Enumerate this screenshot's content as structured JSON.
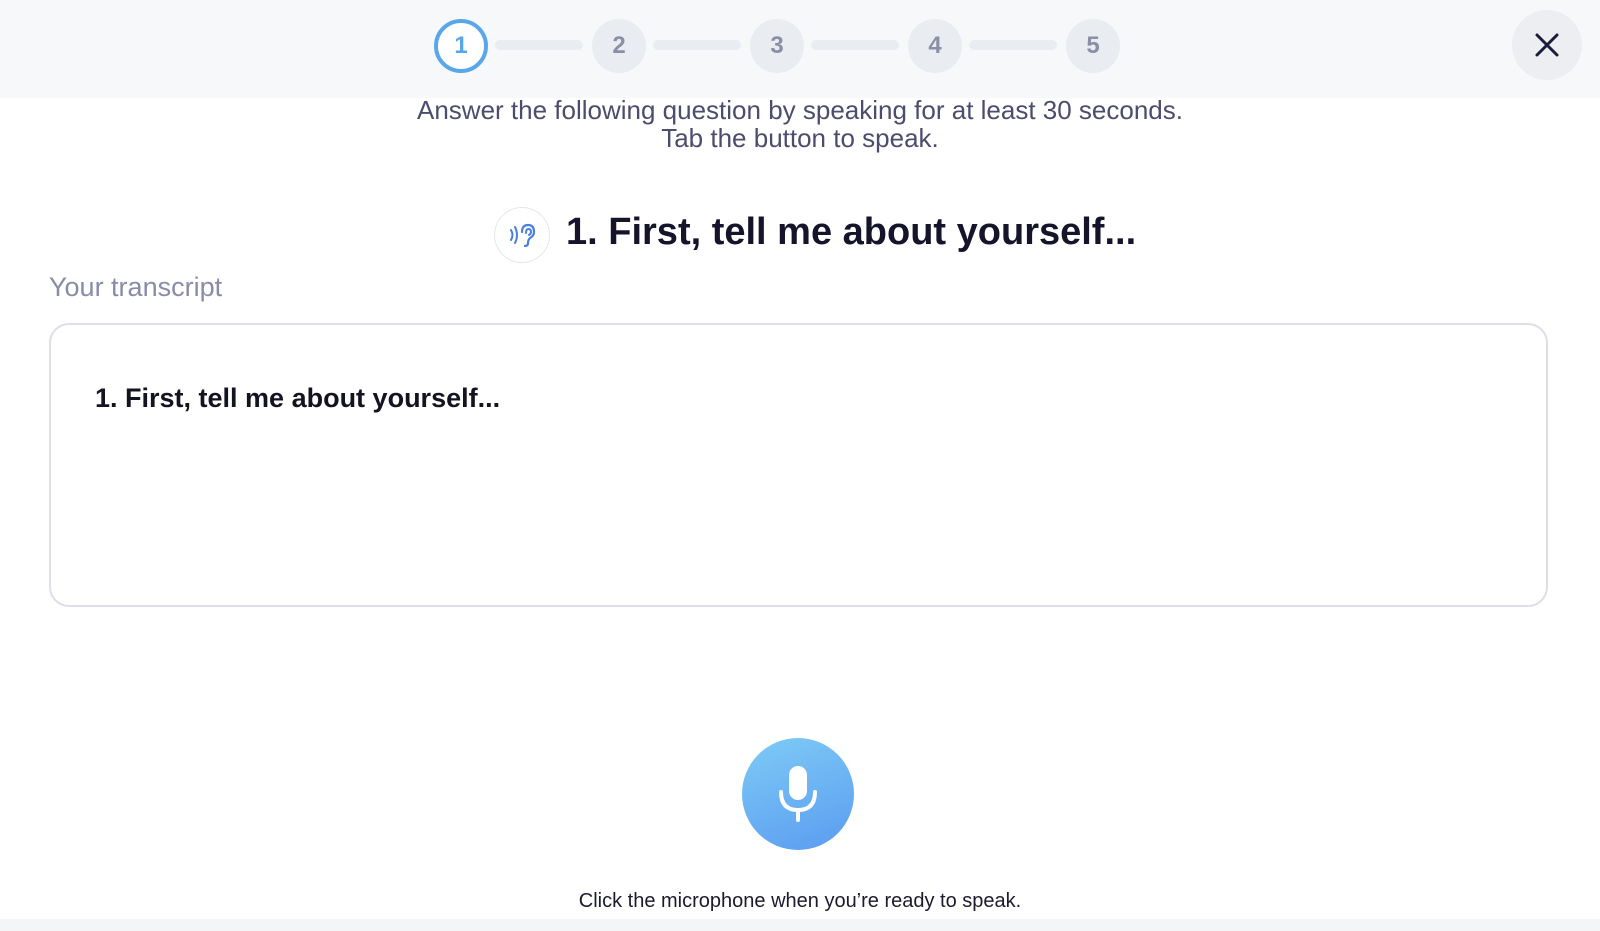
{
  "stepper": {
    "steps": [
      "1",
      "2",
      "3",
      "4",
      "5"
    ],
    "current": 1,
    "active_color": "#5aa6ea",
    "inactive_color": "#e9ecf1"
  },
  "close_icon": "close-icon",
  "instructions": {
    "line1": "Answer the following question by speaking for at least 30 seconds.",
    "line2": "Tab the button to speak."
  },
  "question": {
    "listen_icon": "ear-sound-icon",
    "title": "1. First, tell me about yourself..."
  },
  "transcript": {
    "label": "Your transcript",
    "text": "1. First, tell me about yourself..."
  },
  "microphone": {
    "icon": "microphone-icon",
    "hint": "Click the microphone when you’re ready to speak."
  }
}
